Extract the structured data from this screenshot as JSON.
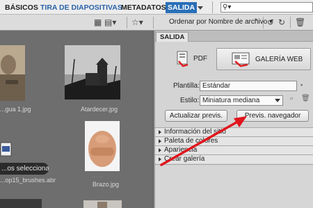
{
  "workspaces": {
    "basicos": "BÁSICOS",
    "tira": "TIRA DE DIAPOSITIVAS",
    "metadatos": "METADATOS",
    "salida": "SALIDA"
  },
  "toolbar": {
    "sort_label": "Ordenar por Nombre de archivo"
  },
  "thumbnails": [
    {
      "caption": "...gua 1.jpg"
    },
    {
      "caption": "Atardecer.jpg"
    },
    {
      "caption": "...op15_brushes.abr"
    },
    {
      "caption": "Brazo.jpg"
    }
  ],
  "tooltip": "...os seleccionados",
  "panel": {
    "tab": "SALIDA",
    "pdf_label": "PDF",
    "web_label": "GALERÍA WEB",
    "plantilla_label": "Plantilla:",
    "plantilla_value": "Estándar",
    "estilo_label": "Estilo:",
    "estilo_value": "Miniatura mediana",
    "refresh_button": "Actualizar previs.",
    "browser_button": "Previs. navegador",
    "sections": [
      "Información del sitio",
      "Paleta de colores",
      "Apariencia",
      "Crear galería"
    ]
  },
  "colors": {
    "accent": "#2a6fb7",
    "arrow": "#e0161c"
  }
}
